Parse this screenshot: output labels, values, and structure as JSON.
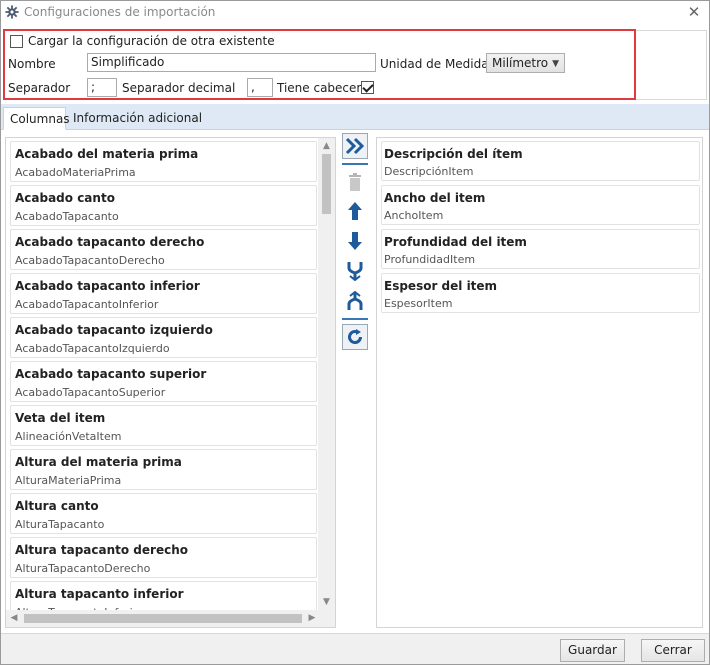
{
  "window": {
    "title": "Configuraciones de importación",
    "close_glyph": "✕",
    "icon": "gear-icon"
  },
  "config": {
    "load_existing_label": "Cargar la configuración de otra existente",
    "load_existing_checked": false,
    "name_label": "Nombre",
    "name_value": "Simplificado",
    "unit_label": "Unidad de Medida :",
    "unit_value": "Milímetro",
    "separator_label": "Separador",
    "separator_value": ";",
    "decimal_separator_label": "Separador decimal",
    "decimal_separator_value": ",",
    "has_header_label": "Tiene cabecera",
    "has_header_checked": true
  },
  "tabs": [
    {
      "label": "Columnas",
      "active": true
    },
    {
      "label": "Información adicional",
      "active": false
    }
  ],
  "available_columns": [
    {
      "title": "Acabado del materia prima",
      "field": "AcabadoMateriaPrima"
    },
    {
      "title": "Acabado canto",
      "field": "AcabadoTapacanto"
    },
    {
      "title": "Acabado tapacanto derecho",
      "field": "AcabadoTapacantoDerecho"
    },
    {
      "title": "Acabado tapacanto inferior",
      "field": "AcabadoTapacantoInferior"
    },
    {
      "title": "Acabado tapacanto izquierdo",
      "field": "AcabadoTapacantoIzquierdo"
    },
    {
      "title": "Acabado tapacanto superior",
      "field": "AcabadoTapacantoSuperior"
    },
    {
      "title": "Veta del item",
      "field": "AlineaciónVetaItem"
    },
    {
      "title": "Altura del materia prima",
      "field": "AlturaMateriaPrima"
    },
    {
      "title": "Altura canto",
      "field": "AlturaTapacanto"
    },
    {
      "title": "Altura tapacanto derecho",
      "field": "AlturaTapacantoDerecho"
    },
    {
      "title": "Altura tapacanto inferior",
      "field": "AlturaTapacantoInferior"
    }
  ],
  "selected_columns": [
    {
      "title": "Descripción del ítem",
      "field": "DescripciónItem"
    },
    {
      "title": "Ancho del item",
      "field": "AnchoItem"
    },
    {
      "title": "Profundidad del item",
      "field": "ProfundidadItem"
    },
    {
      "title": "Espesor del item",
      "field": "EspesorItem"
    }
  ],
  "toolbar": {
    "add_all": "double-chevron-right-icon",
    "delete": "trash-icon",
    "move_up": "arrow-up-icon",
    "move_down": "arrow-down-icon",
    "merge": "merge-icon",
    "split": "split-icon",
    "refresh": "refresh-icon"
  },
  "footer": {
    "save_label": "Guardar",
    "close_label": "Cerrar"
  },
  "colors": {
    "highlight_border": "#e03a3e",
    "tabbar_bg": "#dfe9f5",
    "icon_blue": "#1f5a9a"
  }
}
